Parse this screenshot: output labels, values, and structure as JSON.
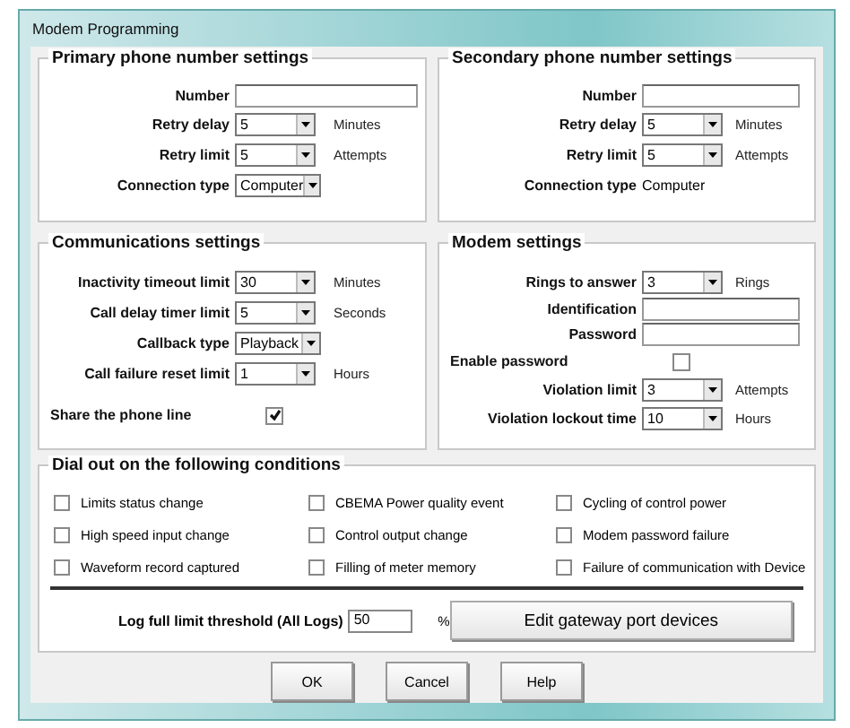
{
  "window": {
    "title": "Modem Programming"
  },
  "primary": {
    "title": "Primary phone number settings",
    "rows": [
      {
        "kind": "text",
        "label": "Number",
        "value": ""
      },
      {
        "kind": "select",
        "label": "Retry delay",
        "value": "5",
        "unit": "Minutes"
      },
      {
        "kind": "select",
        "label": "Retry limit",
        "value": "5",
        "unit": "Attempts"
      },
      {
        "kind": "select_short",
        "label": "Connection type",
        "value": "Computer"
      }
    ]
  },
  "secondary": {
    "title": "Secondary phone number settings",
    "rows": [
      {
        "kind": "text",
        "label": "Number",
        "value": ""
      },
      {
        "kind": "select",
        "label": "Retry delay",
        "value": "5",
        "unit": "Minutes"
      },
      {
        "kind": "select",
        "label": "Retry limit",
        "value": "5",
        "unit": "Attempts"
      },
      {
        "kind": "static",
        "label": "Connection type",
        "value": "Computer"
      }
    ]
  },
  "communications": {
    "title": "Communications settings",
    "rows": [
      {
        "kind": "select",
        "label": "Inactivity timeout limit",
        "value": "30",
        "unit": "Minutes"
      },
      {
        "kind": "select",
        "label": "Call delay timer limit",
        "value": "5",
        "unit": "Seconds"
      },
      {
        "kind": "select_short",
        "label": "Callback type",
        "value": "Playback"
      },
      {
        "kind": "select",
        "label": "Call failure reset limit",
        "value": "1",
        "unit": "Hours"
      },
      {
        "kind": "checkbox",
        "label": "Share the phone line",
        "checked": true
      }
    ]
  },
  "modem": {
    "title": "Modem settings",
    "rows": [
      {
        "kind": "select",
        "label": "Rings to answer",
        "value": "3",
        "unit": "Rings"
      },
      {
        "kind": "text",
        "label": "Identification",
        "value": ""
      },
      {
        "kind": "text",
        "label": "Password",
        "value": ""
      },
      {
        "kind": "checkbox",
        "label": "Enable password",
        "checked": false
      },
      {
        "kind": "select",
        "label": "Violation limit",
        "value": "3",
        "unit": "Attempts"
      },
      {
        "kind": "select",
        "label": "Violation lockout time",
        "value": "10",
        "unit": "Hours"
      }
    ]
  },
  "dial_out": {
    "title": "Dial out on the following conditions",
    "conditions": [
      {
        "label": "Limits status change",
        "checked": false
      },
      {
        "label": "CBEMA Power quality event",
        "checked": false
      },
      {
        "label": "Cycling of control power",
        "checked": false
      },
      {
        "label": "High speed input change",
        "checked": false
      },
      {
        "label": "Control output change",
        "checked": false
      },
      {
        "label": "Modem password failure",
        "checked": false
      },
      {
        "label": "Waveform record captured",
        "checked": false
      },
      {
        "label": "Filling of meter memory",
        "checked": false
      },
      {
        "label": "Failure of communication with Device",
        "checked": false
      }
    ],
    "log_threshold": {
      "label": "Log full limit threshold (All Logs)",
      "value": "50",
      "unit": "%"
    },
    "gateway_button": "Edit gateway port devices"
  },
  "buttons": [
    "OK",
    "Cancel",
    "Help"
  ]
}
